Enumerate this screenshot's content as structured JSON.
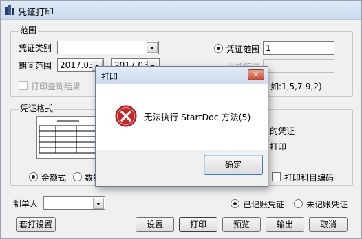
{
  "window": {
    "title": "凭证打印",
    "icon": "printer-app-icon"
  },
  "range": {
    "legend": "范围",
    "type_label": "凭证类别",
    "type_value": "",
    "period_label": "期间范围",
    "period_from": "2017.03",
    "period_to": "2017.03",
    "voucher_range_label": "凭证范围",
    "voucher_range_value": "1",
    "current_voucher_label": "当前凭证",
    "example_hint": "如:1,5,7-9,2)",
    "print_query_label": "打印查询结果"
  },
  "format": {
    "legend": "凭证格式",
    "amount_label": "金额式",
    "qty_label": "数量",
    "opt1_fragment": "的凭证",
    "opt2_fragment": "打印",
    "print_subject_code_label": "打印科目编码"
  },
  "footer": {
    "maker_label": "制单人",
    "maker_value": "",
    "posted_label": "已记账凭证",
    "unposted_label": "未记账凭证",
    "setup_print_btn": "套打设置",
    "settings_btn": "设置",
    "print_btn": "打印",
    "preview_btn": "预览",
    "export_btn": "输出",
    "cancel_btn": "取消"
  },
  "dialog": {
    "title": "打印",
    "close": "✕",
    "message": "无法执行 StartDoc 方法(5)",
    "ok": "确定",
    "icon": "error-icon"
  }
}
